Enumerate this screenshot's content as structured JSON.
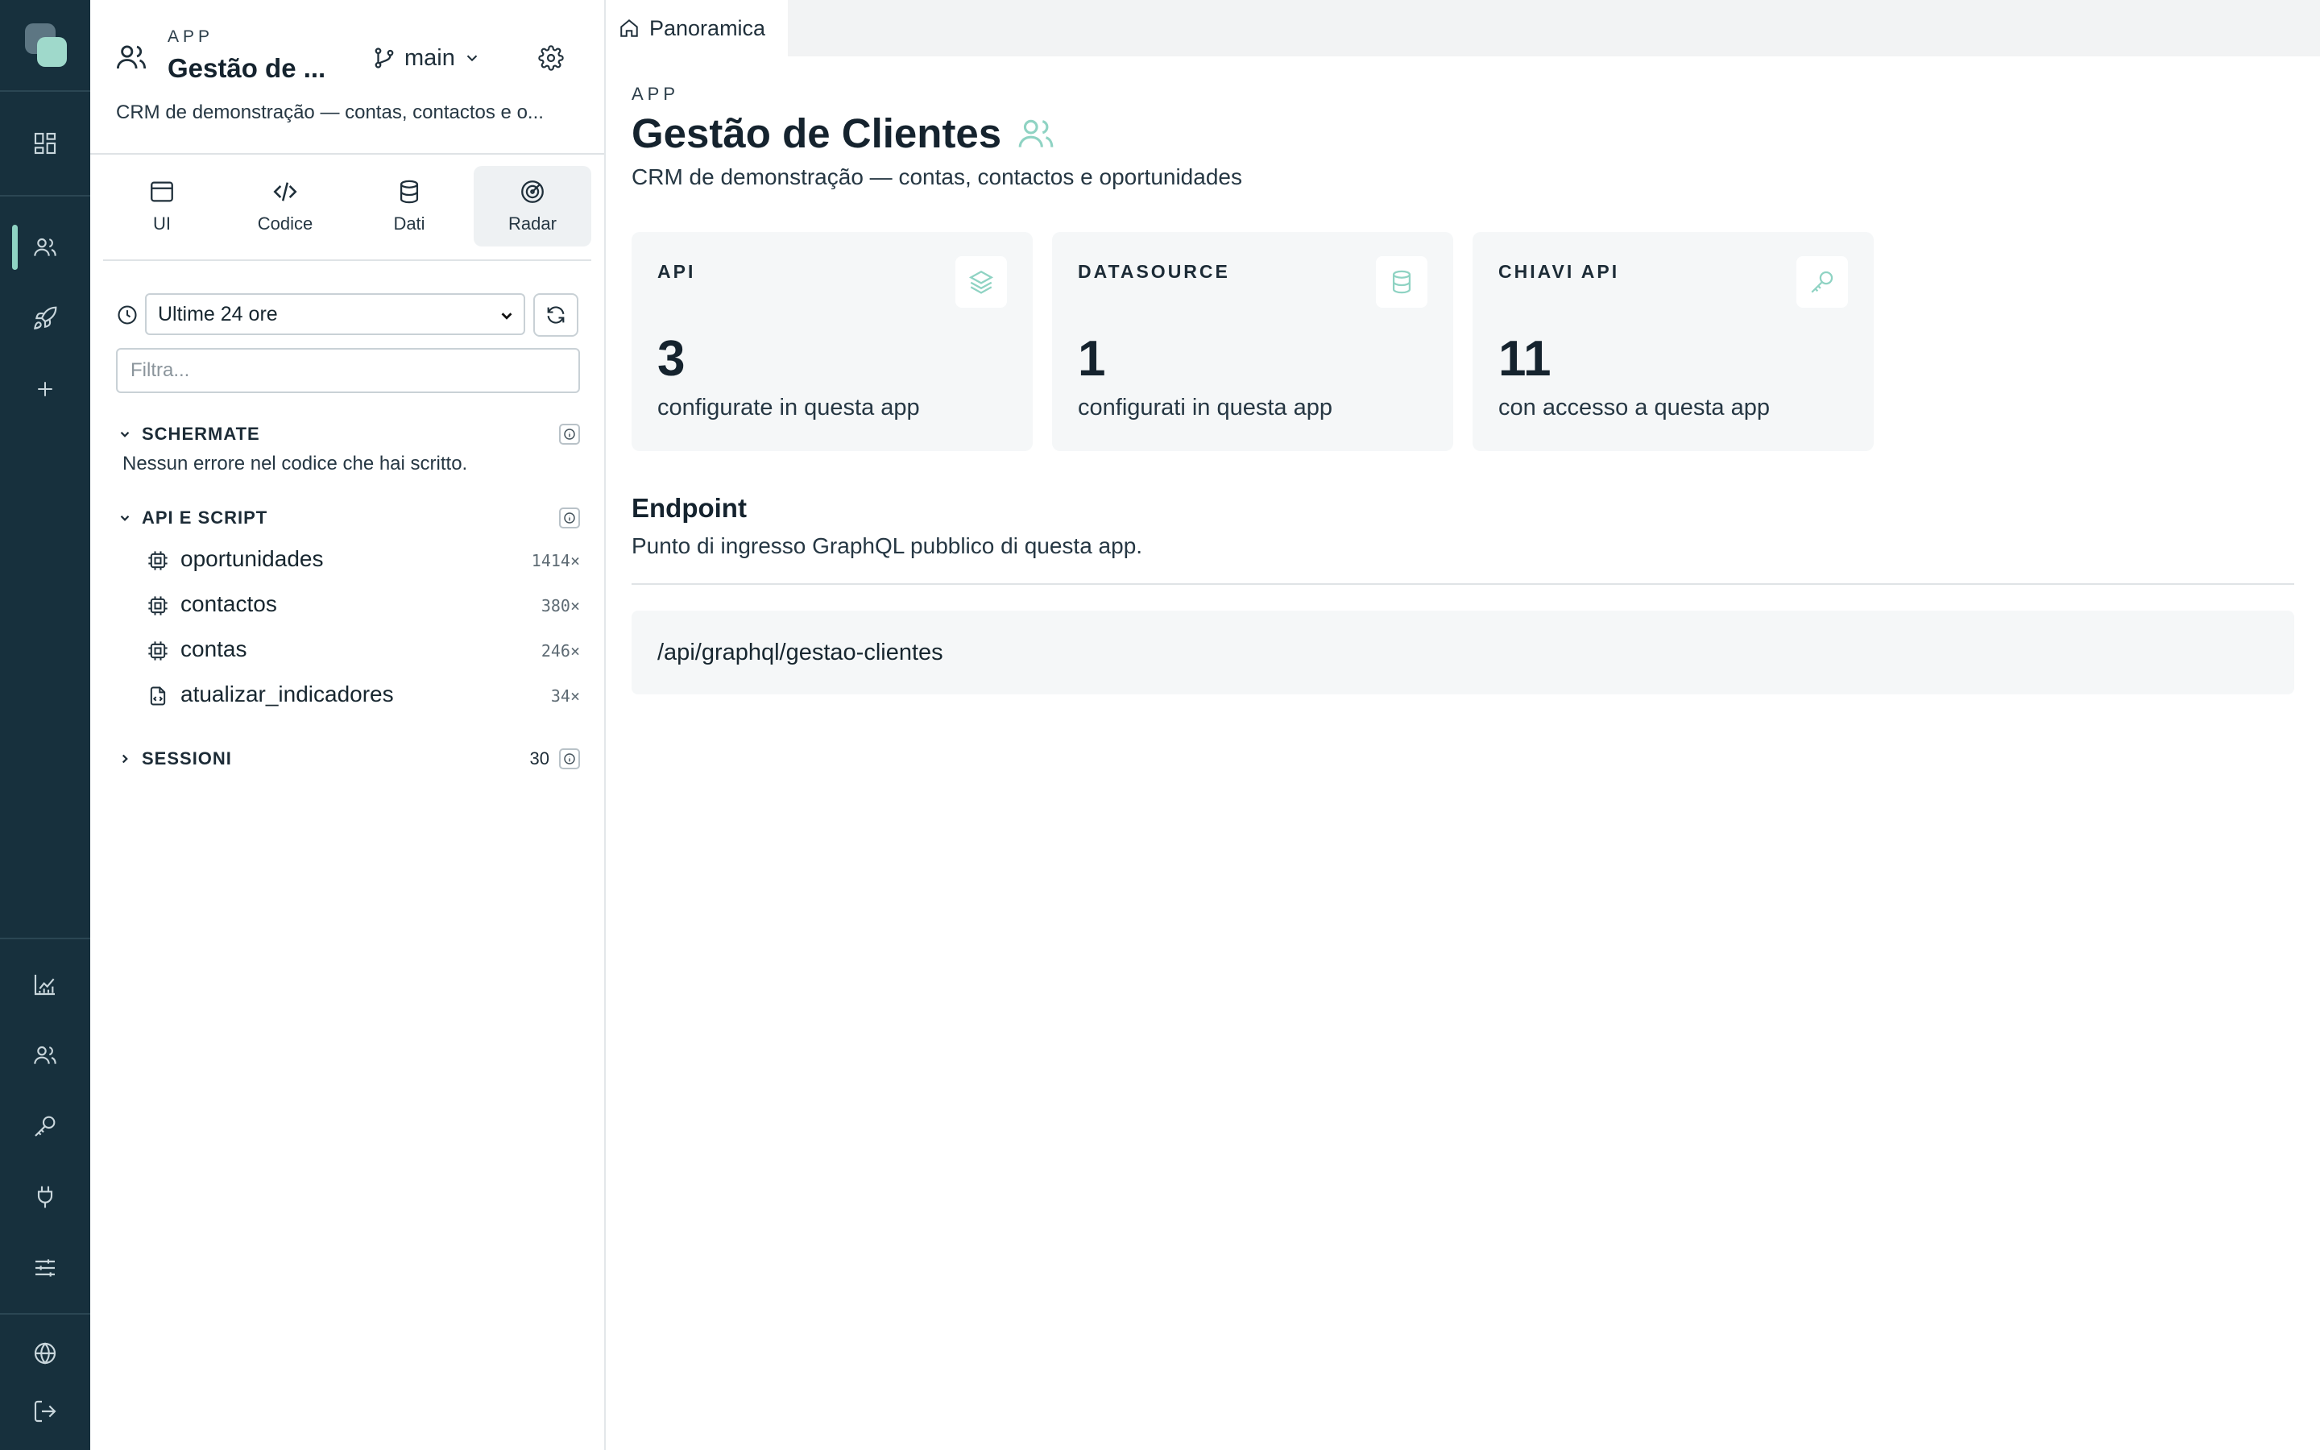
{
  "app": {
    "kicker": "APP",
    "name": "Gestão de ...",
    "description": "CRM de demonstração — contas, contactos e o...",
    "branch": "main"
  },
  "tabs": [
    {
      "label": "UI",
      "icon": "browser-window-icon"
    },
    {
      "label": "Codice",
      "icon": "code-icon"
    },
    {
      "label": "Dati",
      "icon": "database-icon"
    },
    {
      "label": "Radar",
      "icon": "radar-icon",
      "active": true
    }
  ],
  "radar": {
    "time_range": "Ultime 24 ore",
    "filter_placeholder": "Filtra...",
    "sections": {
      "screens": {
        "title": "SCHERMATE",
        "empty_message": "Nessun errore nel codice che hai scritto."
      },
      "api": {
        "title": "API E SCRIPT",
        "items": [
          {
            "name": "oportunidades",
            "hits": "1414×",
            "icon": "chip-icon"
          },
          {
            "name": "contactos",
            "hits": "380×",
            "icon": "chip-icon"
          },
          {
            "name": "contas",
            "hits": "246×",
            "icon": "chip-icon"
          },
          {
            "name": "atualizar_indicadores",
            "hits": "34×",
            "icon": "script-file-icon"
          }
        ]
      },
      "sessions": {
        "title": "SESSIONI",
        "count": "30"
      }
    }
  },
  "page_tab": {
    "label": "Panoramica",
    "icon": "home-icon"
  },
  "overview": {
    "kicker": "APP",
    "title": "Gestão de Clientes",
    "description": "CRM de demonstração — contas, contactos e oportunidades",
    "cards": [
      {
        "label": "API",
        "value": "3",
        "sub": "configurate in questa app",
        "icon": "layers-icon"
      },
      {
        "label": "DATASOURCE",
        "value": "1",
        "sub": "configurati in questa app",
        "icon": "database-icon"
      },
      {
        "label": "CHIAVI API",
        "value": "11",
        "sub": "con accesso a questa app",
        "icon": "key-icon"
      }
    ],
    "endpoint": {
      "title": "Endpoint",
      "description": "Punto di ingresso GraphQL pubblico di questa app.",
      "path": "/api/graphql/gestao-clientes"
    }
  },
  "colors": {
    "rail_bg": "#17303d",
    "accent": "#8fd3c3",
    "card_bg": "#f5f7f8"
  }
}
